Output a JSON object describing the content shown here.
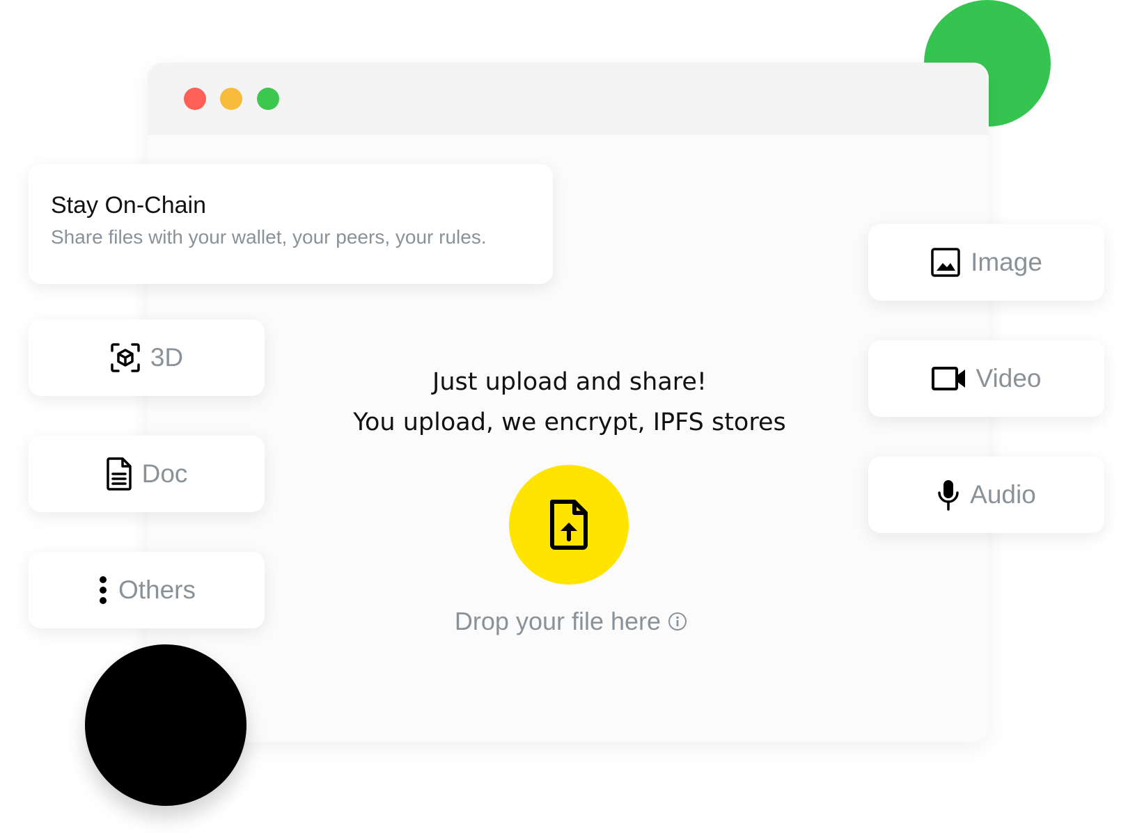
{
  "window": {
    "controls": [
      "close",
      "minimize",
      "maximize"
    ]
  },
  "hero_card": {
    "title": "Stay On-Chain",
    "subtitle": "Share files with your wallet, your peers, your rules."
  },
  "upload": {
    "line1": "Just upload and share!",
    "line2": "You upload, we encrypt, IPFS stores",
    "drop_label": "Drop your file here"
  },
  "file_types": {
    "left": [
      {
        "label": "3D",
        "icon": "cube-scan-icon"
      },
      {
        "label": "Doc",
        "icon": "document-icon"
      },
      {
        "label": "Others",
        "icon": "more-vertical-icon"
      }
    ],
    "right": [
      {
        "label": "Image",
        "icon": "image-icon"
      },
      {
        "label": "Video",
        "icon": "video-camera-icon"
      },
      {
        "label": "Audio",
        "icon": "microphone-icon"
      }
    ]
  },
  "colors": {
    "accent_green": "#36c451",
    "accent_yellow": "#ffe400",
    "traffic_red": "#fe5f57",
    "traffic_yellow": "#f9bc3a",
    "traffic_green": "#3cc74f",
    "muted_text": "#8a9197"
  }
}
